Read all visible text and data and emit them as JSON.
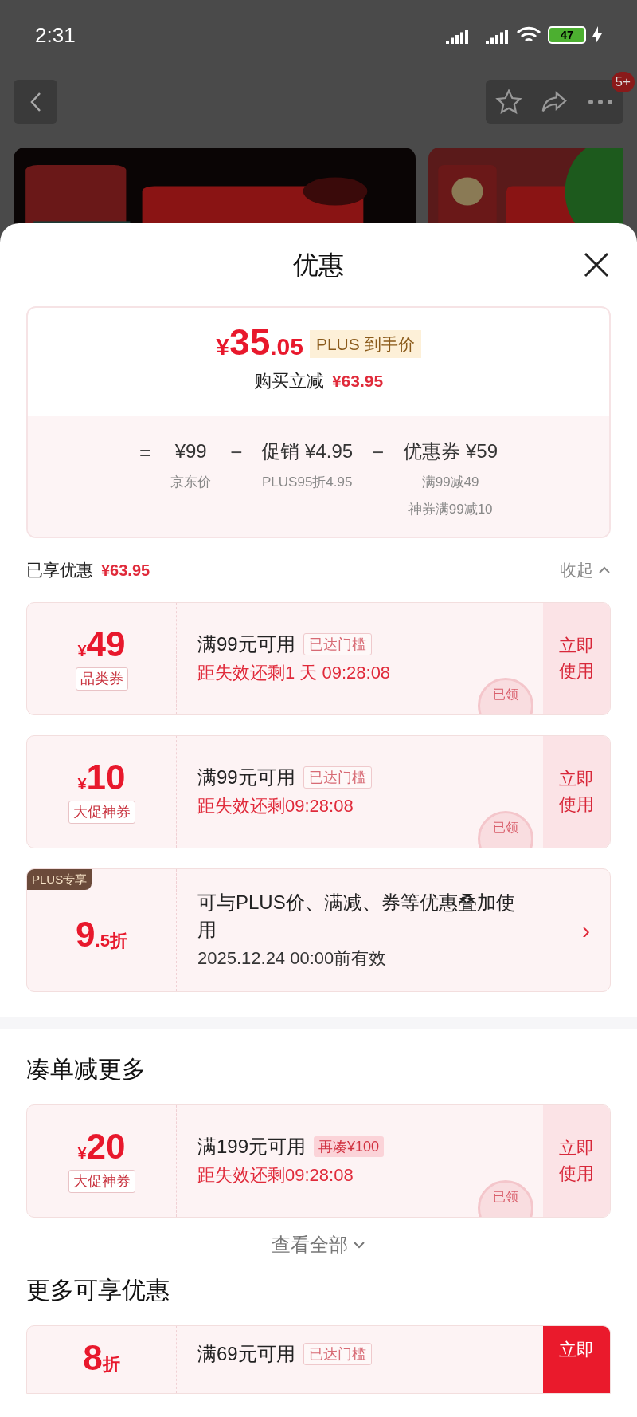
{
  "status_bar": {
    "time": "2:31",
    "battery": "47"
  },
  "nav": {
    "badge": "5+"
  },
  "sheet": {
    "title": "优惠"
  },
  "summary": {
    "price": {
      "symbol": "¥",
      "integer": "35",
      "decimal": ".05"
    },
    "price_badge": "PLUS 到手价",
    "saving_label": "购买立减",
    "saving": "¥63.95",
    "formula": [
      {
        "operator": "=",
        "amount": "¥99",
        "notes": [
          "京东价"
        ]
      },
      {
        "operator": "−",
        "amount": "促销 ¥4.95",
        "notes": [
          "PLUS95折4.95"
        ]
      },
      {
        "operator": "−",
        "amount": "优惠券 ¥59",
        "notes": [
          "满99减49",
          "神券满99减10"
        ]
      }
    ]
  },
  "enjoyed": {
    "label": "已享优惠",
    "amount": "¥63.95",
    "toggle": "收起",
    "expanded": true
  },
  "coupons": [
    {
      "kind": "amount",
      "currency": "¥",
      "value": "49",
      "type_tag": "品类券",
      "condition": "满99元可用",
      "tag": "已达门槛",
      "reached": true,
      "expiry": "距失效还剩1 天 09:28:08",
      "urgent": true,
      "action": {
        "lines": [
          "立即",
          "使用"
        ],
        "highlighted": false
      },
      "stamp": "已领"
    },
    {
      "kind": "amount",
      "currency": "¥",
      "value": "10",
      "type_tag": "大促神券",
      "condition": "满99元可用",
      "tag": "已达门槛",
      "reached": true,
      "expiry": "距失效还剩09:28:08",
      "urgent": true,
      "action": {
        "lines": [
          "立即",
          "使用"
        ],
        "highlighted": false
      },
      "stamp": "已领"
    },
    {
      "kind": "discount",
      "major": "9",
      "minor": ".5折",
      "corner_badge": "PLUS专享",
      "condition": "可与PLUS价、满减、券等优惠叠加使用",
      "expiry": "2025.12.24 00:00前有效",
      "urgent": false,
      "chevron": "›"
    }
  ],
  "gather": {
    "title": "凑单减更多",
    "coupons": [
      {
        "kind": "amount",
        "currency": "¥",
        "value": "20",
        "type_tag": "大促神券",
        "condition": "满199元可用",
        "tag": "再凑¥100",
        "reached": false,
        "expiry": "距失效还剩09:28:08",
        "urgent": true,
        "action": {
          "lines": [
            "立即",
            "使用"
          ],
          "highlighted": false
        },
        "stamp": "已领"
      }
    ],
    "view_all": "查看全部"
  },
  "more": {
    "title": "更多可享优惠",
    "coupons": [
      {
        "kind": "discount",
        "major": "8",
        "minor": "折",
        "condition": "满69元可用",
        "tag": "已达门槛",
        "reached": true,
        "action": {
          "lines": [
            "立即"
          ],
          "highlighted": true
        }
      }
    ]
  }
}
